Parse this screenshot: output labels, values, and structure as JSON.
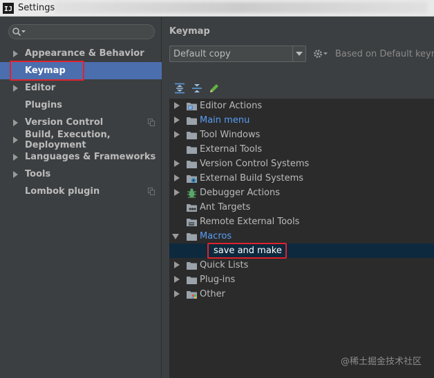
{
  "window": {
    "title": "Settings",
    "app_icon_text": "IJ"
  },
  "search": {
    "value": "",
    "icon": "search-icon"
  },
  "sidebar": {
    "items": [
      {
        "label": "Appearance & Behavior",
        "expandable": true,
        "copy_icon": false,
        "selected": false
      },
      {
        "label": "Keymap",
        "expandable": false,
        "copy_icon": false,
        "selected": true
      },
      {
        "label": "Editor",
        "expandable": true,
        "copy_icon": false,
        "selected": false
      },
      {
        "label": "Plugins",
        "expandable": false,
        "copy_icon": false,
        "selected": false
      },
      {
        "label": "Version Control",
        "expandable": true,
        "copy_icon": true,
        "selected": false
      },
      {
        "label": "Build, Execution, Deployment",
        "expandable": true,
        "copy_icon": false,
        "selected": false
      },
      {
        "label": "Languages & Frameworks",
        "expandable": true,
        "copy_icon": false,
        "selected": false
      },
      {
        "label": "Tools",
        "expandable": true,
        "copy_icon": false,
        "selected": false
      },
      {
        "label": "Lombok plugin",
        "expandable": false,
        "copy_icon": true,
        "selected": false
      }
    ]
  },
  "main": {
    "heading": "Keymap",
    "keymap_select": {
      "value": "Default copy"
    },
    "based_on": "Based on Default keyma",
    "toolbar": [
      {
        "icon": "expand-all-icon"
      },
      {
        "icon": "collapse-all-icon"
      },
      {
        "icon": "edit-pencil-icon"
      }
    ],
    "tree": [
      {
        "label": "Editor Actions",
        "arrow": "closed",
        "icon": "editor-actions-folder-icon",
        "blue": false,
        "level": 0
      },
      {
        "label": "Main menu",
        "arrow": "closed",
        "icon": "folder-icon",
        "blue": true,
        "level": 0
      },
      {
        "label": "Tool Windows",
        "arrow": "closed",
        "icon": "folder-icon",
        "blue": false,
        "level": 0
      },
      {
        "label": "External Tools",
        "arrow": "none",
        "icon": "folder-icon",
        "blue": false,
        "level": 0
      },
      {
        "label": "Version Control Systems",
        "arrow": "closed",
        "icon": "folder-icon",
        "blue": false,
        "level": 0
      },
      {
        "label": "External Build Systems",
        "arrow": "closed",
        "icon": "external-build-folder-icon",
        "blue": false,
        "level": 0
      },
      {
        "label": "Debugger Actions",
        "arrow": "closed",
        "icon": "debugger-bug-icon",
        "blue": false,
        "level": 0
      },
      {
        "label": "Ant Targets",
        "arrow": "none",
        "icon": "ant-targets-folder-icon",
        "blue": false,
        "level": 0
      },
      {
        "label": "Remote External Tools",
        "arrow": "none",
        "icon": "remote-tools-folder-icon",
        "blue": false,
        "level": 0
      },
      {
        "label": "Macros",
        "arrow": "open",
        "icon": "folder-icon",
        "blue": true,
        "level": 0
      },
      {
        "label": "save and make",
        "arrow": "none",
        "icon": "",
        "blue": false,
        "level": 1,
        "selected": true
      },
      {
        "label": "Quick Lists",
        "arrow": "closed",
        "icon": "folder-icon",
        "blue": false,
        "level": 0
      },
      {
        "label": "Plug-ins",
        "arrow": "closed",
        "icon": "folder-icon",
        "blue": false,
        "level": 0
      },
      {
        "label": "Other",
        "arrow": "closed",
        "icon": "other-folder-icon",
        "blue": false,
        "level": 0
      }
    ]
  },
  "colors": {
    "selection_blue": "#4b6eaf",
    "tree_selection": "#0d293e",
    "highlight_red": "#e0232b",
    "link_blue": "#589df6"
  },
  "watermark": "@稀土掘金技术社区"
}
